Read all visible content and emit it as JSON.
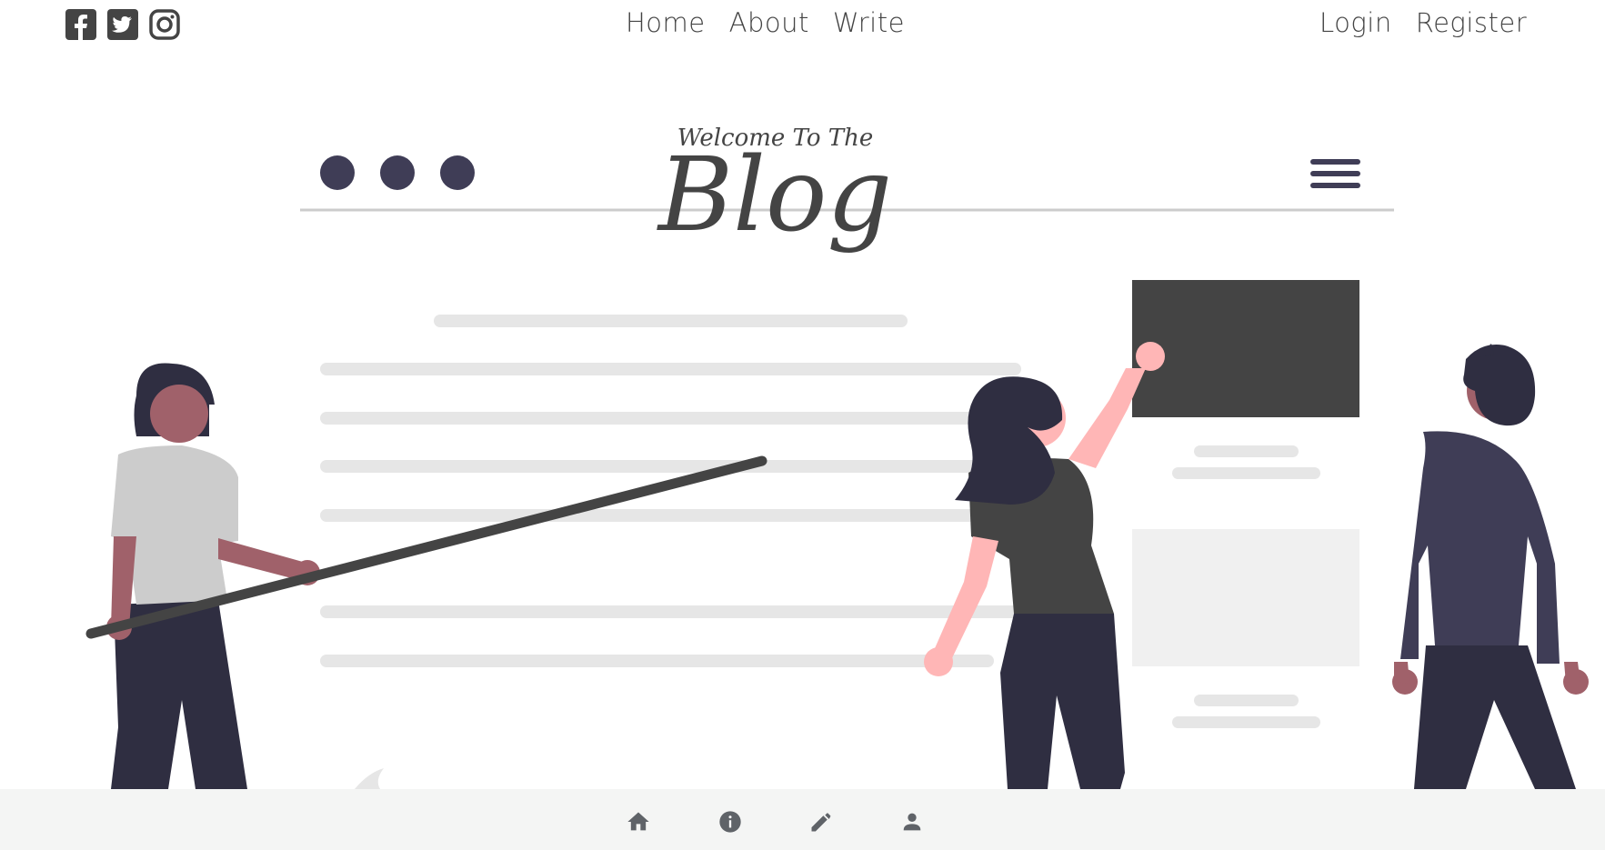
{
  "header": {
    "social_icons": [
      "facebook-icon",
      "twitter-icon",
      "instagram-icon"
    ],
    "nav_center": [
      {
        "label": "Home"
      },
      {
        "label": "About"
      },
      {
        "label": "Write"
      }
    ],
    "nav_right": [
      {
        "label": "Login"
      },
      {
        "label": "Register"
      }
    ]
  },
  "hero": {
    "welcome_text": "Welcome To The",
    "title": "Blog"
  },
  "bottom_nav": {
    "icons": [
      "home-icon",
      "info-icon",
      "edit-icon",
      "person-icon"
    ]
  },
  "colors": {
    "text": "#444444",
    "illustration_dark": "#2f2e41",
    "illustration_panel": "#444444",
    "skin_pink": "#ffb6b6",
    "skin_brown": "#a0616a",
    "bottom_bar": "#f4f5f4"
  }
}
